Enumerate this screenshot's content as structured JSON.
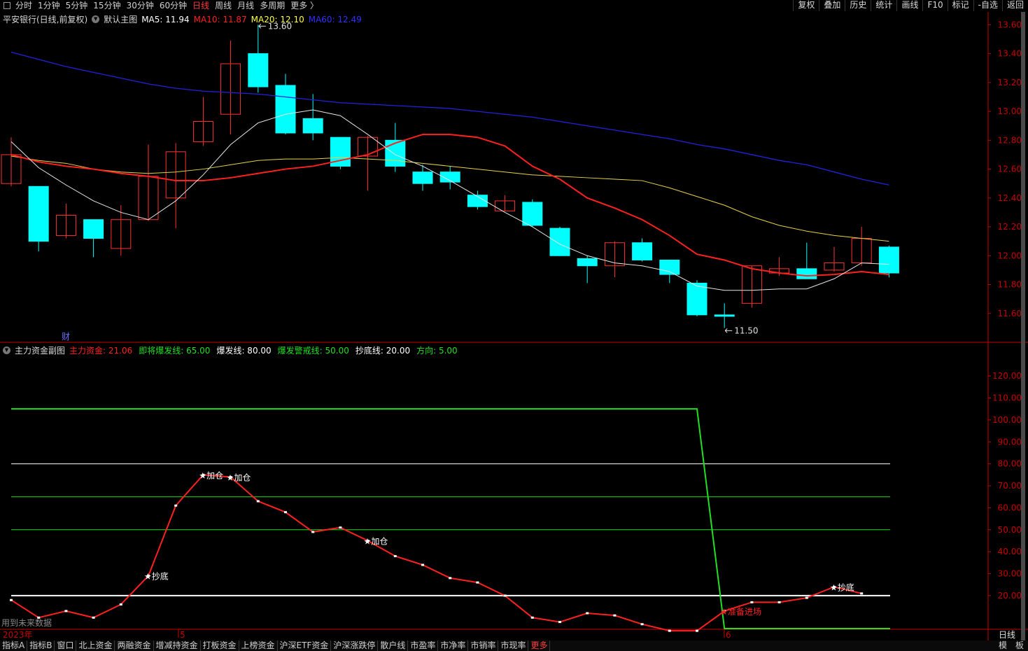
{
  "toolbar": {
    "tabs": [
      "分时",
      "1分钟",
      "5分钟",
      "15分钟",
      "30分钟",
      "60分钟",
      "日线",
      "周线",
      "月线",
      "多周期",
      "更多 〉"
    ],
    "active_tab": 6,
    "right_buttons": [
      "复权",
      "叠加",
      "历史",
      "统计",
      "画线",
      "F10",
      "标记",
      "-自选",
      "返回"
    ]
  },
  "main_chart": {
    "title": "平安银行(日线,前复权)",
    "indicator_name": "默认主图",
    "ma": [
      {
        "label": "MA5: 11.94",
        "color": "#ffffff"
      },
      {
        "label": "MA10: 11.87",
        "color": "#ff2020"
      },
      {
        "label": "MA20: 12.10",
        "color": "#ffff40"
      },
      {
        "label": "MA60: 12.49",
        "color": "#3030ff"
      }
    ],
    "high_label": "13.60",
    "low_label": "11.50",
    "fin_marker": "财",
    "y_ticks": [
      "13.60",
      "13.40",
      "13.20",
      "13.00",
      "12.80",
      "12.60",
      "12.40",
      "12.20",
      "12.00",
      "11.80",
      "11.60"
    ],
    "colors": {
      "up": "#ff3232",
      "down": "#00ffff",
      "axis": "#c80000",
      "ma5": "#e6e6e6",
      "ma10": "#ff2020",
      "ma20": "#e6d24a",
      "ma60": "#2222dd"
    }
  },
  "sub_chart": {
    "title": "主力资金副图",
    "legend": [
      {
        "label": "主力资金: 21.06",
        "color": "#ff2020"
      },
      {
        "label": "即将爆发线: 65.00",
        "color": "#20e020"
      },
      {
        "label": "爆发线: 80.00",
        "color": "#ffffff"
      },
      {
        "label": "爆发警戒线: 50.00",
        "color": "#20e020"
      },
      {
        "label": "抄底线: 20.00",
        "color": "#ffffff"
      },
      {
        "label": "方向: 5.00",
        "color": "#20e020"
      }
    ],
    "y_ticks": [
      "120.00",
      "110.00",
      "100.00",
      "90.00",
      "80.00",
      "70.00",
      "60.00",
      "50.00",
      "40.00",
      "30.00",
      "20.00"
    ],
    "signals": [
      {
        "label": "★抄底",
        "color": "#ffffff"
      },
      {
        "label": "★加仓",
        "color": "#ffffff"
      },
      {
        "label": "★加仓",
        "color": "#ffffff"
      },
      {
        "label": "★加仓",
        "color": "#ffffff"
      },
      {
        "label": "★准备进场",
        "color": "#ff2020"
      },
      {
        "label": "★抄底",
        "color": "#ffffff"
      }
    ],
    "future_note": "用到未来数据"
  },
  "x_axis": {
    "labels": [
      "2023年",
      "5",
      "6"
    ],
    "period": "日线"
  },
  "chart_data": {
    "type": "candlestick",
    "price_ylim": [
      11.4,
      13.66
    ],
    "candles": [
      {
        "o": 12.5,
        "h": 12.82,
        "l": 12.48,
        "c": 12.7
      },
      {
        "o": 12.48,
        "h": 12.48,
        "l": 12.03,
        "c": 12.1
      },
      {
        "o": 12.14,
        "h": 12.36,
        "l": 12.12,
        "c": 12.28
      },
      {
        "o": 12.25,
        "h": 12.25,
        "l": 11.99,
        "c": 12.12
      },
      {
        "o": 12.05,
        "h": 12.35,
        "l": 12.0,
        "c": 12.25
      },
      {
        "o": 12.25,
        "h": 12.77,
        "l": 12.24,
        "c": 12.55
      },
      {
        "o": 12.4,
        "h": 12.78,
        "l": 12.19,
        "c": 12.72
      },
      {
        "o": 12.79,
        "h": 13.1,
        "l": 12.76,
        "c": 12.93
      },
      {
        "o": 12.98,
        "h": 13.49,
        "l": 12.84,
        "c": 13.33
      },
      {
        "o": 13.4,
        "h": 13.6,
        "l": 13.13,
        "c": 13.17
      },
      {
        "o": 13.18,
        "h": 13.26,
        "l": 12.84,
        "c": 12.85
      },
      {
        "o": 12.95,
        "h": 13.12,
        "l": 12.8,
        "c": 12.85
      },
      {
        "o": 12.82,
        "h": 12.82,
        "l": 12.6,
        "c": 12.62
      },
      {
        "o": 12.69,
        "h": 12.83,
        "l": 12.45,
        "c": 12.82
      },
      {
        "o": 12.8,
        "h": 12.92,
        "l": 12.58,
        "c": 12.62
      },
      {
        "o": 12.58,
        "h": 12.63,
        "l": 12.45,
        "c": 12.5
      },
      {
        "o": 12.58,
        "h": 12.62,
        "l": 12.46,
        "c": 12.51
      },
      {
        "o": 12.42,
        "h": 12.45,
        "l": 12.32,
        "c": 12.34
      },
      {
        "o": 12.31,
        "h": 12.42,
        "l": 12.31,
        "c": 12.38
      },
      {
        "o": 12.37,
        "h": 12.39,
        "l": 12.2,
        "c": 12.21
      },
      {
        "o": 12.19,
        "h": 12.2,
        "l": 12.0,
        "c": 12.0
      },
      {
        "o": 11.98,
        "h": 12.0,
        "l": 11.81,
        "c": 11.93
      },
      {
        "o": 11.93,
        "h": 12.1,
        "l": 11.85,
        "c": 12.09
      },
      {
        "o": 12.09,
        "h": 12.12,
        "l": 11.96,
        "c": 11.97
      },
      {
        "o": 11.97,
        "h": 11.97,
        "l": 11.81,
        "c": 11.87
      },
      {
        "o": 11.81,
        "h": 11.83,
        "l": 11.58,
        "c": 11.59
      },
      {
        "o": 11.59,
        "h": 11.67,
        "l": 11.5,
        "c": 11.58
      },
      {
        "o": 11.67,
        "h": 11.93,
        "l": 11.64,
        "c": 11.93
      },
      {
        "o": 11.88,
        "h": 11.99,
        "l": 11.86,
        "c": 11.91
      },
      {
        "o": 11.91,
        "h": 12.09,
        "l": 11.84,
        "c": 11.84
      },
      {
        "o": 11.9,
        "h": 12.06,
        "l": 11.89,
        "c": 11.95
      },
      {
        "o": 11.95,
        "h": 12.2,
        "l": 11.93,
        "c": 12.12
      },
      {
        "o": 12.06,
        "h": 12.07,
        "l": 11.85,
        "c": 11.88
      }
    ],
    "ma5": [
      12.79,
      12.61,
      12.49,
      12.38,
      12.3,
      12.25,
      12.38,
      12.56,
      12.77,
      12.92,
      12.98,
      13.01,
      12.97,
      12.84,
      12.7,
      12.62,
      12.52,
      12.41,
      12.3,
      12.2,
      12.08,
      12.0,
      11.95,
      11.93,
      11.89,
      11.79,
      11.76,
      11.76,
      11.77,
      11.77,
      11.84,
      11.95,
      11.94
    ],
    "ma10": [
      12.7,
      12.65,
      12.62,
      12.6,
      12.57,
      12.55,
      12.52,
      12.52,
      12.54,
      12.57,
      12.6,
      12.62,
      12.66,
      12.7,
      12.78,
      12.84,
      12.84,
      12.82,
      12.76,
      12.62,
      12.53,
      12.4,
      12.33,
      12.25,
      12.14,
      12.01,
      11.97,
      11.91,
      11.88,
      11.86,
      11.87,
      11.89,
      11.87
    ],
    "ma20": [
      12.69,
      12.66,
      12.64,
      12.6,
      12.58,
      12.57,
      12.58,
      12.6,
      12.63,
      12.66,
      12.67,
      12.67,
      12.68,
      12.67,
      12.66,
      12.64,
      12.62,
      12.6,
      12.58,
      12.56,
      12.55,
      12.54,
      12.53,
      12.52,
      12.47,
      12.41,
      12.35,
      12.27,
      12.21,
      12.17,
      12.14,
      12.12,
      12.1
    ],
    "ma60": [
      13.41,
      13.36,
      13.31,
      13.27,
      13.23,
      13.19,
      13.16,
      13.14,
      13.13,
      13.12,
      13.1,
      13.08,
      13.06,
      13.05,
      13.04,
      13.03,
      13.02,
      13.0,
      12.98,
      12.96,
      12.93,
      12.9,
      12.87,
      12.84,
      12.81,
      12.77,
      12.74,
      12.7,
      12.66,
      12.63,
      12.58,
      12.53,
      12.49
    ],
    "sub_ylim": [
      5,
      128
    ],
    "main_force": [
      18,
      10,
      13,
      10,
      16,
      29,
      61,
      75,
      74,
      63,
      58,
      49,
      51,
      45,
      38,
      34,
      28,
      26,
      20,
      10,
      8,
      12,
      11,
      7,
      4,
      4,
      13,
      17,
      17,
      19,
      24,
      21
    ],
    "direction": [
      105,
      105,
      105,
      105,
      105,
      105,
      105,
      105,
      105,
      105,
      105,
      105,
      105,
      105,
      105,
      105,
      105,
      105,
      105,
      105,
      105,
      105,
      105,
      105,
      105,
      105,
      5,
      5,
      5,
      5,
      5,
      5
    ],
    "signal_index": [
      5,
      7,
      8,
      13,
      26,
      30
    ],
    "ref_lines": [
      {
        "name": "爆发线",
        "value": 80,
        "color": "#ffffff"
      },
      {
        "name": "即将爆发线",
        "value": 65,
        "color": "#20e020"
      },
      {
        "name": "爆发警戒线",
        "value": 50,
        "color": "#20e020"
      },
      {
        "name": "抄底线",
        "value": 20,
        "color": "#ffffff"
      }
    ]
  }
}
